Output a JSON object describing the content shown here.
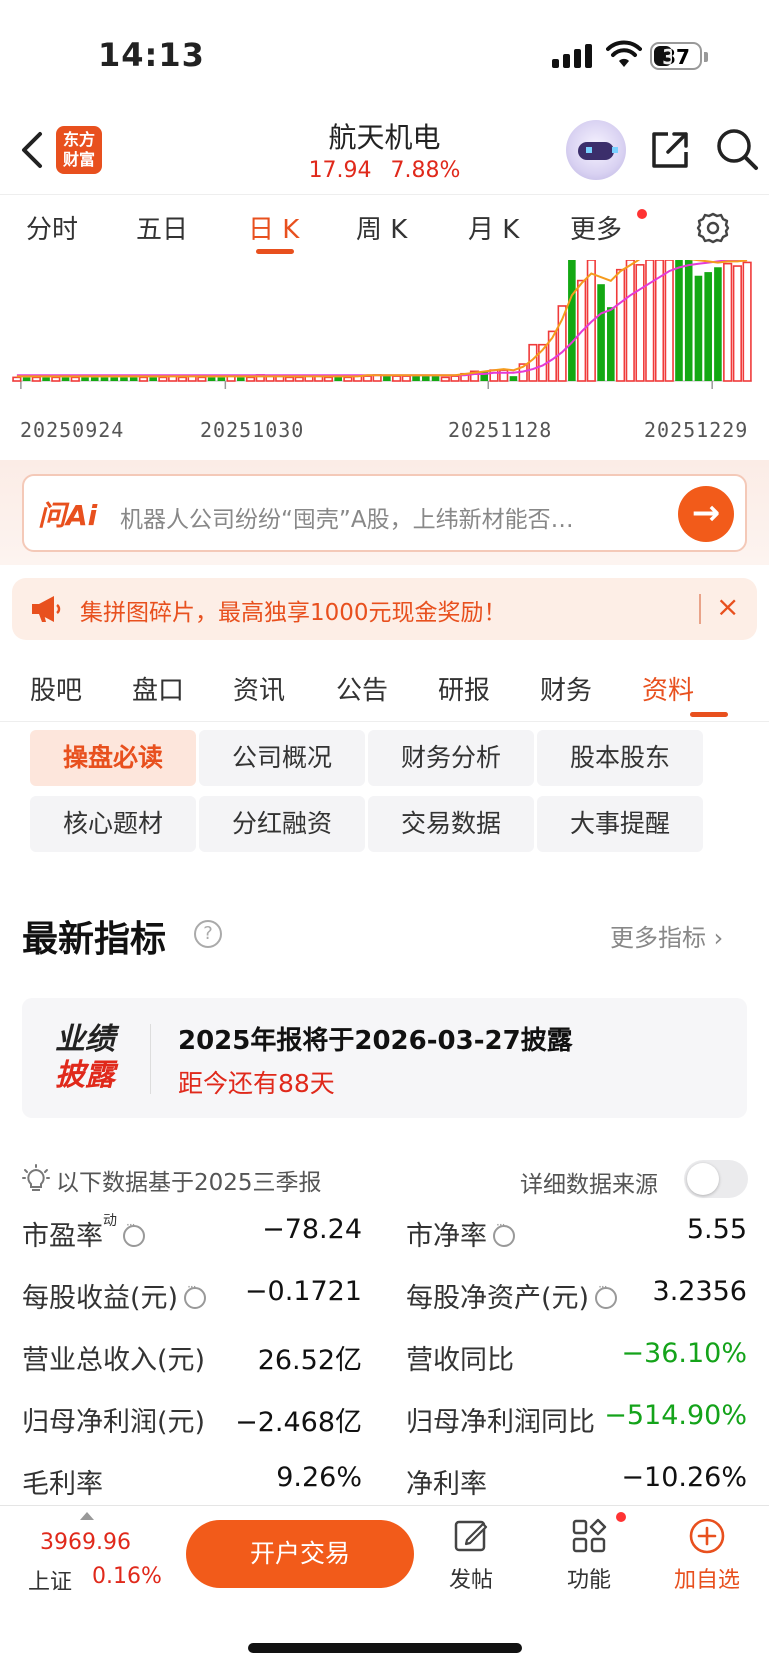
{
  "status_bar": {
    "time": "14:13",
    "battery": "37"
  },
  "header": {
    "logo_line1": "东方",
    "logo_line2": "财富",
    "stock_name": "航天机电",
    "price": "17.94",
    "change_pct": "7.88%"
  },
  "period_tabs": [
    {
      "label": "分时"
    },
    {
      "label": "五日"
    },
    {
      "label": "日 K"
    },
    {
      "label": "周 K"
    },
    {
      "label": "月 K"
    },
    {
      "label": "更多"
    }
  ],
  "period_active": "日 K",
  "chart_data": {
    "type": "bar",
    "description_type": "daily volume bars with moving averages",
    "x_tick_labels": [
      "20250924",
      "20251030",
      "20251128",
      "20251229"
    ],
    "colors": {
      "up": "#f03a3a",
      "down": "#13a813",
      "ma_fast": "#f59b1d",
      "ma_slow": "#e43ad6"
    },
    "bars": [
      {
        "v": 3,
        "d": "up"
      },
      {
        "v": 3,
        "d": "down"
      },
      {
        "v": 3,
        "d": "up"
      },
      {
        "v": 3,
        "d": "down"
      },
      {
        "v": 3,
        "d": "up"
      },
      {
        "v": 3,
        "d": "down"
      },
      {
        "v": 3,
        "d": "up"
      },
      {
        "v": 3,
        "d": "down"
      },
      {
        "v": 3,
        "d": "down"
      },
      {
        "v": 3,
        "d": "down"
      },
      {
        "v": 3,
        "d": "down"
      },
      {
        "v": 3,
        "d": "down"
      },
      {
        "v": 3,
        "d": "down"
      },
      {
        "v": 3,
        "d": "up"
      },
      {
        "v": 3,
        "d": "down"
      },
      {
        "v": 3,
        "d": "up"
      },
      {
        "v": 4,
        "d": "up"
      },
      {
        "v": 3,
        "d": "up"
      },
      {
        "v": 4,
        "d": "up"
      },
      {
        "v": 3,
        "d": "up"
      },
      {
        "v": 3,
        "d": "down"
      },
      {
        "v": 3,
        "d": "down"
      },
      {
        "v": 4,
        "d": "up"
      },
      {
        "v": 3,
        "d": "down"
      },
      {
        "v": 3,
        "d": "up"
      },
      {
        "v": 5,
        "d": "up"
      },
      {
        "v": 4,
        "d": "up"
      },
      {
        "v": 4,
        "d": "up"
      },
      {
        "v": 3,
        "d": "up"
      },
      {
        "v": 3,
        "d": "up"
      },
      {
        "v": 4,
        "d": "up"
      },
      {
        "v": 4,
        "d": "up"
      },
      {
        "v": 3,
        "d": "up"
      },
      {
        "v": 4,
        "d": "down"
      },
      {
        "v": 3,
        "d": "up"
      },
      {
        "v": 4,
        "d": "up"
      },
      {
        "v": 4,
        "d": "up"
      },
      {
        "v": 5,
        "d": "up"
      },
      {
        "v": 4,
        "d": "down"
      },
      {
        "v": 4,
        "d": "up"
      },
      {
        "v": 4,
        "d": "up"
      },
      {
        "v": 4,
        "d": "down"
      },
      {
        "v": 4,
        "d": "down"
      },
      {
        "v": 4,
        "d": "down"
      },
      {
        "v": 3,
        "d": "up"
      },
      {
        "v": 4,
        "d": "up"
      },
      {
        "v": 6,
        "d": "up"
      },
      {
        "v": 8,
        "d": "up"
      },
      {
        "v": 8,
        "d": "down"
      },
      {
        "v": 9,
        "d": "up"
      },
      {
        "v": 9,
        "d": "up"
      },
      {
        "v": 4,
        "d": "down"
      },
      {
        "v": 14,
        "d": "up"
      },
      {
        "v": 30,
        "d": "up"
      },
      {
        "v": 30,
        "d": "up"
      },
      {
        "v": 41,
        "d": "up"
      },
      {
        "v": 62,
        "d": "up"
      },
      {
        "v": 100,
        "d": "down"
      },
      {
        "v": 83,
        "d": "up"
      },
      {
        "v": 100,
        "d": "up"
      },
      {
        "v": 80,
        "d": "down"
      },
      {
        "v": 61,
        "d": "down"
      },
      {
        "v": 92,
        "d": "up"
      },
      {
        "v": 100,
        "d": "up"
      },
      {
        "v": 96,
        "d": "up"
      },
      {
        "v": 100,
        "d": "up"
      },
      {
        "v": 100,
        "d": "up"
      },
      {
        "v": 100,
        "d": "up"
      },
      {
        "v": 100,
        "d": "down"
      },
      {
        "v": 100,
        "d": "down"
      },
      {
        "v": 87,
        "d": "down"
      },
      {
        "v": 90,
        "d": "down"
      },
      {
        "v": 94,
        "d": "down"
      },
      {
        "v": 97,
        "d": "up"
      },
      {
        "v": 95,
        "d": "up"
      },
      {
        "v": 98,
        "d": "up"
      }
    ],
    "ma_fast": [
      3,
      3,
      3,
      3,
      3,
      3,
      3,
      3,
      3,
      3,
      3,
      3,
      3,
      3,
      3,
      3,
      3,
      3,
      3,
      3,
      3,
      3,
      3,
      3,
      3,
      3,
      3,
      3,
      3,
      3,
      3,
      3,
      3,
      3,
      3,
      3,
      4,
      4,
      4,
      4,
      4,
      4,
      4,
      4,
      4,
      4,
      5,
      6,
      7,
      8,
      9,
      8,
      11,
      17,
      25,
      35,
      50,
      70,
      80,
      88,
      85,
      82,
      90,
      95,
      100,
      100,
      100,
      100,
      100,
      100,
      99,
      98,
      97,
      98,
      98,
      99
    ],
    "ma_slow": [
      4,
      4,
      4,
      4,
      4,
      4,
      4,
      4,
      4,
      4,
      4,
      4,
      4,
      4,
      4,
      4,
      4,
      4,
      4,
      4,
      4,
      4,
      4,
      4,
      4,
      4,
      4,
      4,
      4,
      4,
      4,
      4,
      4,
      4,
      4,
      4,
      4,
      4,
      4,
      4,
      4,
      4,
      4,
      4,
      4,
      4,
      4,
      5,
      5,
      6,
      6,
      6,
      7,
      9,
      12,
      17,
      23,
      31,
      40,
      48,
      55,
      58,
      64,
      70,
      75,
      80,
      85,
      90,
      93,
      95,
      96,
      97,
      98,
      99,
      99,
      100
    ]
  },
  "ai_search": {
    "logo": "问Ai",
    "placeholder": "机器人公司纷纷“囤壳”A股，上纬新材能否…",
    "go": "→"
  },
  "promo": {
    "text": "集拼图碎片，最高独享1000元现金奖励！",
    "close": "×"
  },
  "main_tabs": [
    {
      "label": "股吧"
    },
    {
      "label": "盘口"
    },
    {
      "label": "资讯"
    },
    {
      "label": "公告"
    },
    {
      "label": "研报"
    },
    {
      "label": "财务"
    },
    {
      "label": "资料"
    }
  ],
  "main_active": "资料",
  "sub_tabs": [
    {
      "label": "操盘必读"
    },
    {
      "label": "公司概况"
    },
    {
      "label": "财务分析"
    },
    {
      "label": "股本股东"
    },
    {
      "label": "核心题材"
    },
    {
      "label": "分红融资"
    },
    {
      "label": "交易数据"
    },
    {
      "label": "大事提醒"
    }
  ],
  "indicators": {
    "title": "最新指标",
    "help": "?",
    "more": "更多指标 ›",
    "disclosure": {
      "badge_line1": "业绩",
      "badge_line2": "披露",
      "main": "2025年报将于2026-03-27披露",
      "sub": "距今还有88天"
    },
    "note": "以下数据基于2025三季报",
    "source_label": "详细数据来源",
    "metrics": [
      {
        "label": "市盈率",
        "sup": "动",
        "info": true,
        "value": "−78.24",
        "neg": false
      },
      {
        "label": "市净率",
        "sup": "",
        "info": true,
        "value": "5.55",
        "neg": false
      },
      {
        "label": "每股收益(元)",
        "sup": "",
        "info": true,
        "value": "−0.1721",
        "neg": false
      },
      {
        "label": "每股净资产(元)",
        "sup": "",
        "info": true,
        "value": "3.2356",
        "neg": false
      },
      {
        "label": "营业总收入(元)",
        "sup": "",
        "info": false,
        "value": "26.52亿",
        "neg": false
      },
      {
        "label": "营收同比",
        "sup": "",
        "info": false,
        "value": "−36.10%",
        "neg": true
      },
      {
        "label": "归母净利润(元)",
        "sup": "",
        "info": false,
        "value": "−2.468亿",
        "neg": false
      },
      {
        "label": "归母净利润同比",
        "sup": "",
        "info": false,
        "value": "−514.90%",
        "neg": true
      },
      {
        "label": "毛利率",
        "sup": "",
        "info": false,
        "value": "9.26%",
        "neg": false
      },
      {
        "label": "净利率",
        "sup": "",
        "info": false,
        "value": "−10.26%",
        "neg": false
      }
    ]
  },
  "bottom_bar": {
    "index_value": "3969.96",
    "index_name": "上证",
    "index_change": "0.16%",
    "trade_button": "开户交易",
    "post": "发帖",
    "functions": "功能",
    "add_watch": "加自选"
  }
}
